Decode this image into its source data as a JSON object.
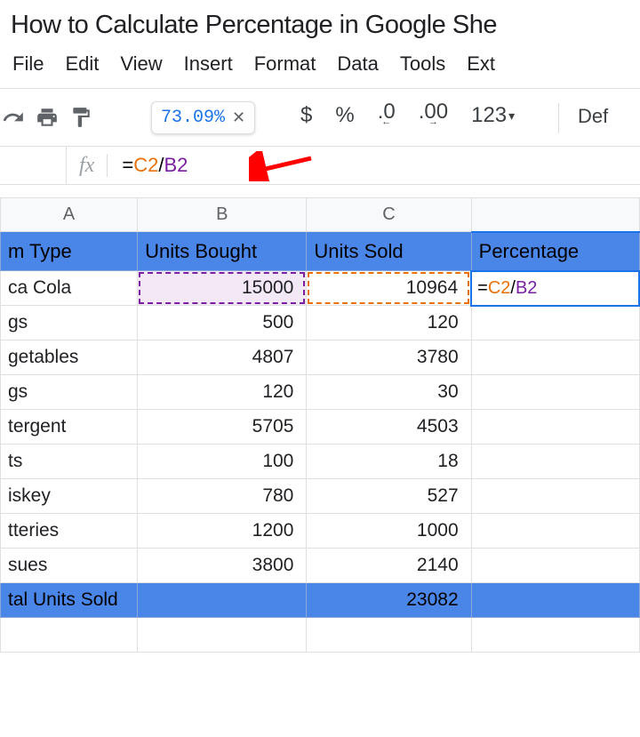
{
  "title": "How to Calculate Percentage in Google She",
  "menus": [
    "File",
    "Edit",
    "View",
    "Insert",
    "Format",
    "Data",
    "Tools",
    "Ext"
  ],
  "tooltip_value": "73.09%",
  "toolbar": {
    "currency": "$",
    "percent": "%",
    "dec_dec": ".0",
    "inc_dec": ".00",
    "numfmt": "123",
    "font": "Def"
  },
  "fx_symbol": "fx",
  "formula": {
    "eq": "=",
    "ref1": "C2",
    "slash": "/",
    "ref2": "B2"
  },
  "columns": [
    "A",
    "B",
    "C",
    ""
  ],
  "headers": [
    "m Type",
    "Units Bought",
    "Units Sold",
    "Percentage"
  ],
  "chart_data": {
    "type": "table",
    "columns": [
      "Item Type",
      "Units Bought",
      "Units Sold"
    ],
    "rows": [
      {
        "A": "ca Cola",
        "B": "15000",
        "C": "10964"
      },
      {
        "A": "gs",
        "B": "500",
        "C": "120"
      },
      {
        "A": "getables",
        "B": "4807",
        "C": "3780"
      },
      {
        "A": "gs",
        "B": "120",
        "C": "30"
      },
      {
        "A": "tergent",
        "B": "5705",
        "C": "4503"
      },
      {
        "A": "ts",
        "B": "100",
        "C": "18"
      },
      {
        "A": "iskey",
        "B": "780",
        "C": "527"
      },
      {
        "A": "tteries",
        "B": "1200",
        "C": "1000"
      },
      {
        "A": "sues",
        "B": "3800",
        "C": "2140"
      }
    ],
    "total_row": {
      "label": "tal Units Sold",
      "C": "23082"
    }
  },
  "cell_formula": {
    "eq": "=",
    "ref1": "C2",
    "slash": "/",
    "ref2": "B2"
  }
}
